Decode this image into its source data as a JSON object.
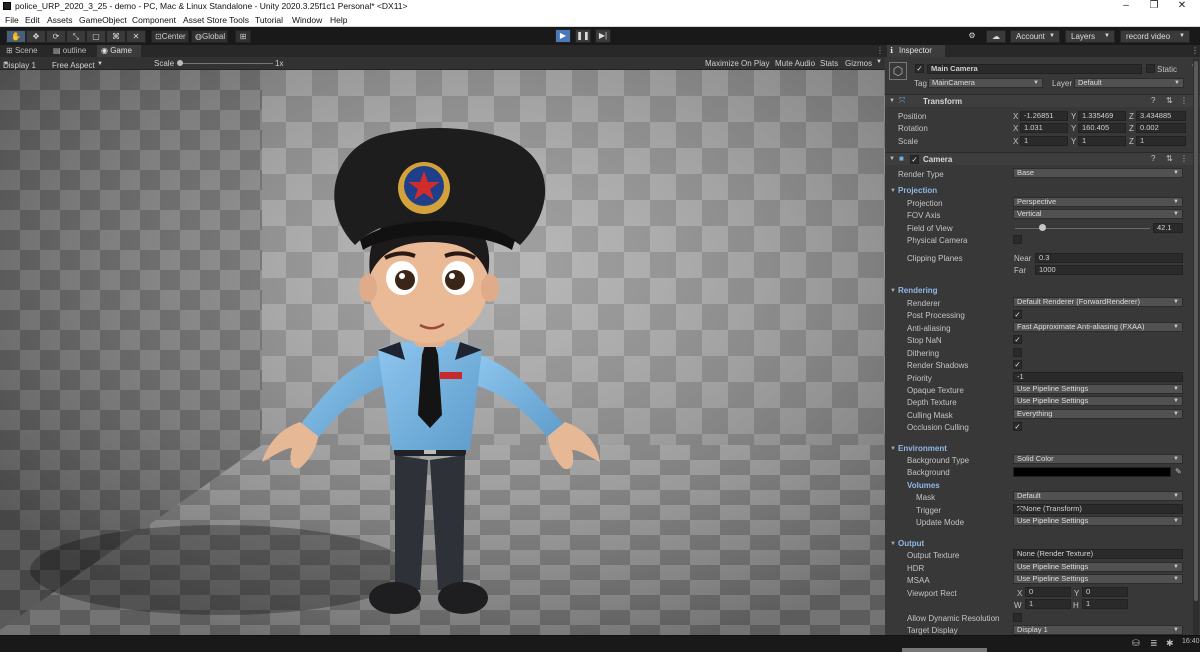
{
  "window": {
    "title": "police_URP_2020_3_25 - demo - PC, Mac & Linux Standalone - Unity 2020.3.25f1c1 Personal* <DX11>",
    "minimize": "–",
    "maximize": "❐",
    "close": "✕"
  },
  "menu": [
    "File",
    "Edit",
    "Assets",
    "GameObject",
    "Component",
    "Asset Store Tools",
    "Tutorial",
    "Window",
    "Help"
  ],
  "toolbar": {
    "tools": [
      "hand-tool",
      "move-tool",
      "rotate-tool",
      "scale-tool",
      "rect-tool",
      "transform-tool",
      "custom-tool"
    ],
    "pivot": "Center",
    "space": "Global",
    "account": "Account",
    "layers": "Layers",
    "layout": "record video"
  },
  "tabs": {
    "scene": "Scene",
    "outline": "outline",
    "game": "Game"
  },
  "gamebar": {
    "display": "Display 1",
    "aspect": "Free Aspect",
    "scale_label": "Scale",
    "scale_value": "1x",
    "maximize": "Maximize On Play",
    "mute": "Mute Audio",
    "stats": "Stats",
    "gizmos": "Gizmos"
  },
  "inspector": {
    "tab": "Inspector",
    "object_name": "Main Camera",
    "static": "Static",
    "tag_label": "Tag",
    "tag_value": "MainCamera",
    "layer_label": "Layer",
    "layer_value": "Default",
    "transform": {
      "title": "Transform",
      "position_label": "Position",
      "rotation_label": "Rotation",
      "scale_label": "Scale",
      "position": {
        "x": "-1.26851",
        "y": "1.335469",
        "z": "3.434885"
      },
      "rotation": {
        "x": "1.031",
        "y": "160.405",
        "z": "0.002"
      },
      "scale": {
        "x": "1",
        "y": "1",
        "z": "1"
      },
      "axis_x": "X",
      "axis_y": "Y",
      "axis_z": "Z"
    },
    "camera": {
      "title": "Camera",
      "render_type_label": "Render Type",
      "render_type": "Base",
      "projection_header": "Projection",
      "projection_label": "Projection",
      "projection": "Perspective",
      "fov_axis_label": "FOV Axis",
      "fov_axis": "Vertical",
      "fov_label": "Field of View",
      "fov": "42.1",
      "fov_fraction": 0.2,
      "physical_label": "Physical Camera",
      "clipping_label": "Clipping Planes",
      "near_label": "Near",
      "near": "0.3",
      "far_label": "Far",
      "far": "1000",
      "rendering_header": "Rendering",
      "renderer_label": "Renderer",
      "renderer": "Default Renderer (ForwardRenderer)",
      "post_label": "Post Processing",
      "aa_label": "Anti-aliasing",
      "aa": "Fast Approximate Anti-aliasing (FXAA)",
      "stopnan_label": "Stop NaN",
      "dither_label": "Dithering",
      "shadows_label": "Render Shadows",
      "priority_label": "Priority",
      "priority": "-1",
      "opaque_label": "Opaque Texture",
      "opaque": "Use Pipeline Settings",
      "depth_label": "Depth Texture",
      "depth": "Use Pipeline Settings",
      "culling_label": "Culling Mask",
      "culling": "Everything",
      "occlusion_label": "Occlusion Culling",
      "environment_header": "Environment",
      "bgtype_label": "Background Type",
      "bgtype": "Solid Color",
      "bg_label": "Background",
      "bg_color": "#000000",
      "volumes_label": "Volumes",
      "mask_label": "Mask",
      "mask": "Default",
      "trigger_label": "Trigger",
      "trigger": "None (Transform)",
      "update_label": "Update Mode",
      "update": "Use Pipeline Settings",
      "output_header": "Output",
      "outtex_label": "Output Texture",
      "outtex": "None (Render Texture)",
      "hdr_label": "HDR",
      "hdr": "Use Pipeline Settings",
      "msaa_label": "MSAA",
      "msaa": "Use Pipeline Settings",
      "viewport_label": "Viewport Rect",
      "vx_label": "X",
      "vx": "0",
      "vy_label": "Y",
      "vy": "0",
      "vw_label": "W",
      "vw": "1",
      "vh_label": "H",
      "vh": "1",
      "dynres_label": "Allow Dynamic Resolution",
      "target_label": "Target Display",
      "target": "Display 1"
    }
  },
  "status": {
    "time": "16:40"
  },
  "colors": {
    "accent": "#4a78b8",
    "header": "#8fb8e6"
  }
}
